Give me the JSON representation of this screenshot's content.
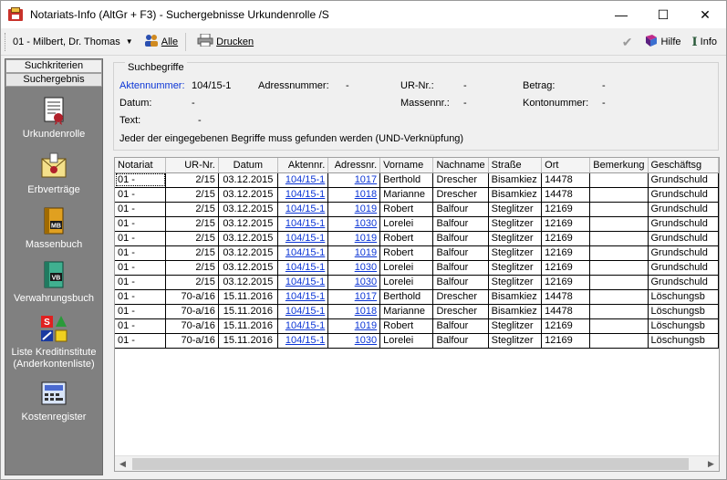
{
  "window": {
    "title": "Notariats-Info (AltGr + F3) - Suchergebnisse Urkundenrolle /S",
    "controls": {
      "minimize": "—",
      "maximize": "☐",
      "close": "✕"
    }
  },
  "toolbar": {
    "user_select": "01 - Milbert, Dr. Thomas",
    "all_label": "Alle",
    "print_label": "Drucken",
    "help_label": "Hilfe",
    "info_label": "Info"
  },
  "nav": {
    "tabs": [
      "Suchkriterien",
      "Suchergebnis"
    ],
    "items": [
      {
        "label": "Urkundenrolle",
        "icon": "document-seal-icon"
      },
      {
        "label": "Erbverträge",
        "icon": "envelope-seal-icon"
      },
      {
        "label": "Massenbuch",
        "icon": "book-mb-icon"
      },
      {
        "label": "Verwahrungsbuch",
        "icon": "book-vb-icon"
      },
      {
        "label": "Liste Kreditinstitute",
        "label2": "(Anderkontenliste)",
        "icon": "bank-logos-icon"
      },
      {
        "label": "Kostenregister",
        "icon": "calculator-icon"
      }
    ]
  },
  "criteria": {
    "legend": "Suchbegriffe",
    "aktennummer_label": "Aktennummer:",
    "aktennummer_value": "104/15-1",
    "adressnummer_label": "Adressnummer:",
    "adressnummer_value": "-",
    "urnr_label": "UR-Nr.:",
    "urnr_value": "-",
    "betrag_label": "Betrag:",
    "betrag_value": "-",
    "datum_label": "Datum:",
    "datum_value": "-",
    "massennr_label": "Massennr.:",
    "massennr_value": "-",
    "kontonummer_label": "Kontonummer:",
    "kontonummer_value": "-",
    "text_label": "Text:",
    "text_value": "-",
    "hint": "Jeder der eingegebenen Begriffe muss gefunden werden (UND-Verknüpfung)"
  },
  "table": {
    "columns": [
      "Notariat",
      "UR-Nr.",
      "Datum",
      "Aktennr.",
      "Adressnr.",
      "Vorname",
      "Nachname",
      "Straße",
      "Ort",
      "Bemerkung",
      "Geschäftsg"
    ],
    "rows": [
      [
        "01 -",
        "2/15",
        "03.12.2015",
        "104/15-1",
        "1017",
        "Berthold",
        "Drescher",
        "Bisamkiez",
        "14478",
        "",
        "Grundschuld"
      ],
      [
        "01 -",
        "2/15",
        "03.12.2015",
        "104/15-1",
        "1018",
        "Marianne",
        "Drescher",
        "Bisamkiez",
        "14478",
        "",
        "Grundschuld"
      ],
      [
        "01 -",
        "2/15",
        "03.12.2015",
        "104/15-1",
        "1019",
        "Robert",
        "Balfour",
        "Steglitzer",
        "12169",
        "",
        "Grundschuld"
      ],
      [
        "01 -",
        "2/15",
        "03.12.2015",
        "104/15-1",
        "1030",
        "Lorelei",
        "Balfour",
        "Steglitzer",
        "12169",
        "",
        "Grundschuld"
      ],
      [
        "01 -",
        "2/15",
        "03.12.2015",
        "104/15-1",
        "1019",
        "Robert",
        "Balfour",
        "Steglitzer",
        "12169",
        "",
        "Grundschuld"
      ],
      [
        "01 -",
        "2/15",
        "03.12.2015",
        "104/15-1",
        "1019",
        "Robert",
        "Balfour",
        "Steglitzer",
        "12169",
        "",
        "Grundschuld"
      ],
      [
        "01 -",
        "2/15",
        "03.12.2015",
        "104/15-1",
        "1030",
        "Lorelei",
        "Balfour",
        "Steglitzer",
        "12169",
        "",
        "Grundschuld"
      ],
      [
        "01 -",
        "2/15",
        "03.12.2015",
        "104/15-1",
        "1030",
        "Lorelei",
        "Balfour",
        "Steglitzer",
        "12169",
        "",
        "Grundschuld"
      ],
      [
        "01 -",
        "70-a/16",
        "15.11.2016",
        "104/15-1",
        "1017",
        "Berthold",
        "Drescher",
        "Bisamkiez",
        "14478",
        "",
        "Löschungsb"
      ],
      [
        "01 -",
        "70-a/16",
        "15.11.2016",
        "104/15-1",
        "1018",
        "Marianne",
        "Drescher",
        "Bisamkiez",
        "14478",
        "",
        "Löschungsb"
      ],
      [
        "01 -",
        "70-a/16",
        "15.11.2016",
        "104/15-1",
        "1019",
        "Robert",
        "Balfour",
        "Steglitzer",
        "12169",
        "",
        "Löschungsb"
      ],
      [
        "01 -",
        "70-a/16",
        "15.11.2016",
        "104/15-1",
        "1030",
        "Lorelei",
        "Balfour",
        "Steglitzer",
        "12169",
        "",
        "Löschungsb"
      ]
    ]
  },
  "colors": {
    "link": "#0b35d6",
    "nav_bg": "#808080"
  }
}
